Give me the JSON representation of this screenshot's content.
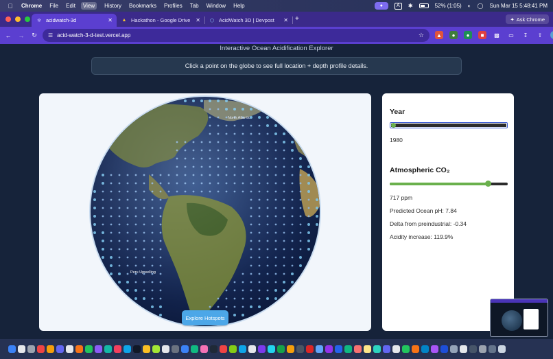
{
  "menubar": {
    "app_name": "Chrome",
    "items": [
      "File",
      "Edit",
      "View",
      "History",
      "Bookmarks",
      "Profiles",
      "Tab",
      "Window",
      "Help"
    ],
    "battery": "52% (1:05)",
    "datetime": "Sun Mar 15  5:48:41 PM",
    "input_label": "A"
  },
  "tabs": [
    {
      "title": "acidwatch-3d",
      "active": true,
      "icon": "app-icon"
    },
    {
      "title": "Hackathon - Google Drive",
      "active": false,
      "icon": "google-drive-icon"
    },
    {
      "title": "AcidWatch 3D | Devpost",
      "active": false,
      "icon": "devpost-icon"
    }
  ],
  "ask_chrome": "Ask Chrome",
  "address_bar": {
    "url": "acid-watch-3-d-test.vercel.app"
  },
  "page": {
    "subtitle": "Interactive Ocean Acidification Explorer",
    "hint": "Click a point on the globe to see full location + depth profile details.",
    "globe_labels": {
      "north": "North Atlantic",
      "south": "Peru Upwelling"
    },
    "explore_button": "Explore Hotspots",
    "controls": {
      "year_label": "Year",
      "year_value": "1980",
      "year_fraction": 0.02,
      "co2_label": "Atmospheric CO₂",
      "co2_value": "717 ppm",
      "co2_fraction": 0.83,
      "predicted_ph": "Predicted Ocean pH: 7.84",
      "delta": "Delta from preindustrial: -0.34",
      "acidity": "Acidity increase: 119.9%"
    }
  },
  "colors": {
    "accent": "#5b3fd0",
    "page_bg": "#16233a",
    "slider_green": "#6ab04c",
    "button_blue": "#4ca7e8"
  }
}
